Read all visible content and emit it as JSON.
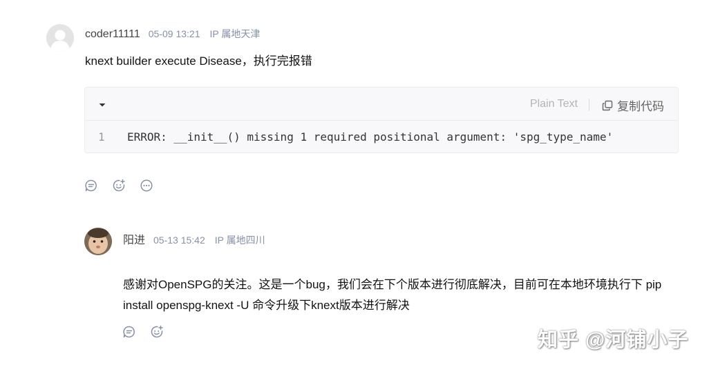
{
  "comments": [
    {
      "author": "coder11111",
      "time": "05-09 13:21",
      "ip": "IP 属地天津",
      "content": "knext builder execute Disease，执行完报错",
      "code_block": {
        "language": "Plain Text",
        "copy_label": "复制代码",
        "line_number": "1",
        "code": "ERROR: __init__() missing 1 required positional argument: 'spg_type_name'"
      },
      "actions": [
        "comment-icon",
        "emoji-reaction-icon",
        "more-icon"
      ]
    },
    {
      "author": "阳进",
      "time": "05-13 15:42",
      "ip": "IP 属地四川",
      "content": "感谢对OpenSPG的关注。这是一个bug，我们会在下个版本进行彻底解决，目前可在本地环境执行下 pip install openspg-knext -U 命令升级下knext版本进行解决",
      "actions": [
        "comment-icon",
        "emoji-reaction-icon"
      ]
    }
  ],
  "watermark": "知乎 @河铺小子",
  "colors": {
    "meta_gray": "#8590a6",
    "text": "#121212",
    "code_bg": "#f8f8fa",
    "icon_gray": "#8590a6"
  }
}
